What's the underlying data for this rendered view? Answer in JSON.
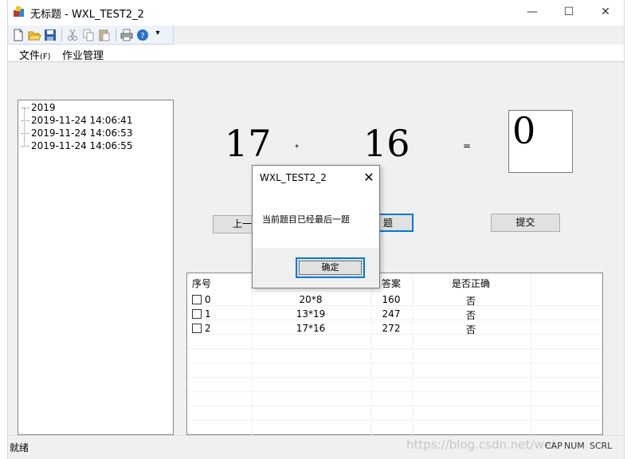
{
  "window": {
    "title": "无标题 - WXL_TEST2_2",
    "minimize_glyph": "—",
    "maximize_glyph": "☐",
    "close_glyph": "✕"
  },
  "toolbar": {
    "icons": [
      "new-file-icon",
      "open-folder-icon",
      "save-icon",
      "cut-icon",
      "copy-icon",
      "paste-icon",
      "print-icon",
      "help-icon"
    ],
    "overflow_glyph": "▾"
  },
  "menu": {
    "file": "文件",
    "file_accel": "(F)",
    "homework": "作业管理"
  },
  "tree": {
    "root": "2019",
    "items": [
      "2019-11-24 14:06:41",
      "2019-11-24 14:06:53",
      "2019-11-24 14:06:55"
    ]
  },
  "problem": {
    "operand1": "17",
    "operator": "*",
    "operand2": "16",
    "equals": "=",
    "answer": "0"
  },
  "buttons": {
    "prev": "上一",
    "next": "题",
    "submit": "提交"
  },
  "list": {
    "headers": [
      "序号",
      "",
      "答案",
      "是否正确"
    ],
    "rows": [
      {
        "index": "0",
        "expr": "20*8",
        "answer": "160",
        "correct": "否"
      },
      {
        "index": "1",
        "expr": "13*19",
        "answer": "247",
        "correct": "否"
      },
      {
        "index": "2",
        "expr": "17*16",
        "answer": "272",
        "correct": "否"
      }
    ]
  },
  "status": {
    "text": "就绪",
    "cap": "CAP",
    "num": "NUM",
    "scrl": "SCRL",
    "watermark": "https://blog.csdn.net/wei"
  },
  "dialog": {
    "title": "WXL_TEST2_2",
    "close_glyph": "✕",
    "message": "当前题目已经最后一题",
    "ok": "确定"
  },
  "colors": {
    "accent": "#0078d7",
    "face": "#f0f0f0"
  }
}
